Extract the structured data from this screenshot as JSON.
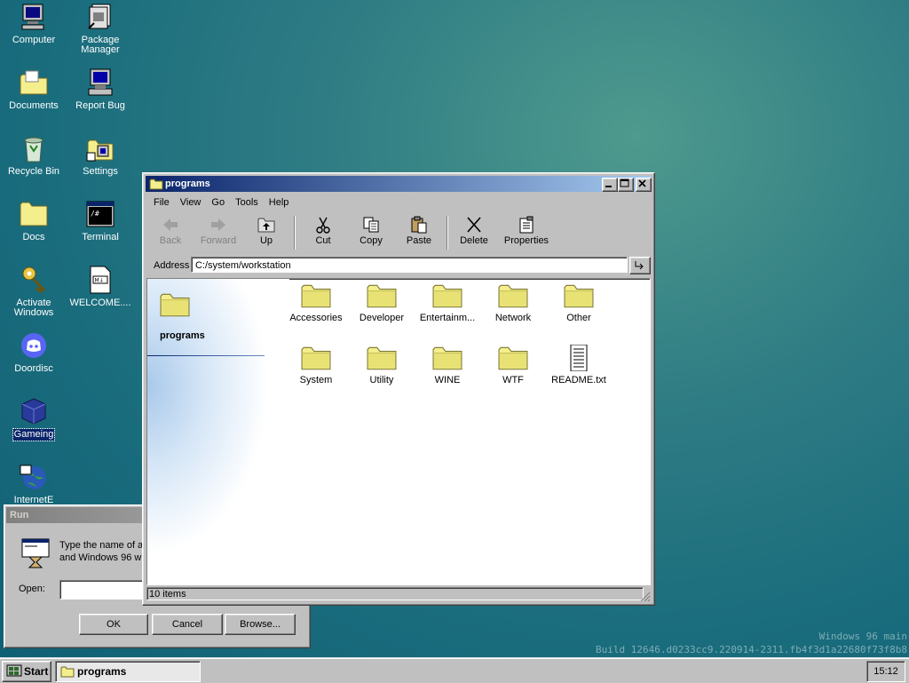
{
  "desktop": {
    "icons": [
      {
        "label": "Computer"
      },
      {
        "label": "Package Manager"
      },
      {
        "label": "Documents"
      },
      {
        "label": "Report Bug"
      },
      {
        "label": "Recycle Bin"
      },
      {
        "label": "Settings"
      },
      {
        "label": "Docs"
      },
      {
        "label": "Terminal"
      },
      {
        "label": "Activate Windows"
      },
      {
        "label": "WELCOME...."
      },
      {
        "label": "Doordisc"
      },
      {
        "label": "Gameing"
      },
      {
        "label": "InternetE"
      }
    ],
    "watermark_line1": "Windows 96 main",
    "watermark_line2": "Build 12646.d0233cc9.220914-2311.fb4f3d1a22680f73f8b8"
  },
  "run_dialog": {
    "title": "Run",
    "description": "Type the name of a p and Windows 96 will",
    "description_line1": "Type the name of a p",
    "description_line2": "and Windows 96 will",
    "open_label": "Open:",
    "open_value": "",
    "ok_label": "OK",
    "cancel_label": "Cancel",
    "browse_label": "Browse..."
  },
  "explorer": {
    "title": "programs",
    "menu": [
      "File",
      "View",
      "Go",
      "Tools",
      "Help"
    ],
    "toolbar": {
      "back": "Back",
      "forward": "Forward",
      "up": "Up",
      "cut": "Cut",
      "copy": "Copy",
      "paste": "Paste",
      "delete": "Delete",
      "properties": "Properties"
    },
    "address_label": "Address",
    "address_value": "C:/system/workstation",
    "side_title": "programs",
    "files": [
      {
        "name": "Accessories",
        "type": "folder"
      },
      {
        "name": "Developer",
        "type": "folder"
      },
      {
        "name": "Entertainm...",
        "type": "folder"
      },
      {
        "name": "Network",
        "type": "folder"
      },
      {
        "name": "Other",
        "type": "folder"
      },
      {
        "name": "System",
        "type": "folder"
      },
      {
        "name": "Utility",
        "type": "folder"
      },
      {
        "name": "WINE",
        "type": "folder"
      },
      {
        "name": "WTF",
        "type": "folder"
      },
      {
        "name": "README.txt",
        "type": "text-file"
      }
    ],
    "status": "10 items"
  },
  "taskbar": {
    "start_label": "Start",
    "tasks": [
      {
        "label": "programs"
      }
    ],
    "clock": "15:12"
  },
  "colors": {
    "desktop": "#1f7280",
    "titlebar_active": "#0a246a",
    "folder": "#ece77a",
    "face": "#c0c0c0"
  }
}
